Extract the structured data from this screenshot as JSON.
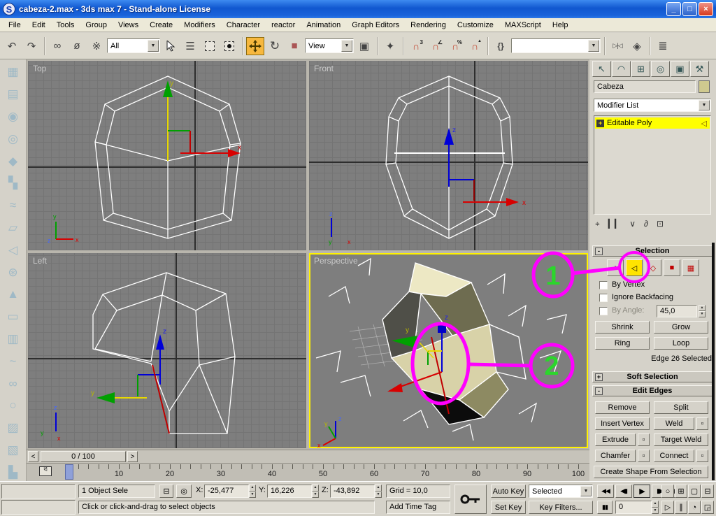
{
  "window": {
    "title": "cabeza-2.max - 3ds max 7  - Stand-alone License",
    "app_icon_letter": "S",
    "minimize": "_",
    "restore": "□",
    "close": "×"
  },
  "menu": [
    "File",
    "Edit",
    "Tools",
    "Group",
    "Views",
    "Create",
    "Modifiers",
    "Character",
    "reactor",
    "Animation",
    "Graph Editors",
    "Rendering",
    "Customize",
    "MAXScript",
    "Help"
  ],
  "toolbar": {
    "undo": "↶",
    "redo": "↷",
    "link": "∞",
    "unlink": "ø",
    "bind_spacewarp": "※",
    "selection_filter": "All",
    "select_by_name": "☰",
    "rotate": "↻",
    "scale": "■",
    "coord_system": "View",
    "pivot_center": "▣",
    "manipulate": "✦",
    "snap3": "∩",
    "snap3_badge": "3",
    "angle_snap": "∩",
    "angle_badge": "∠",
    "percent_snap": "∩",
    "percent_badge": "%",
    "spinner_snap": "∩",
    "spinner_badge": "▲",
    "named_sets": "{}",
    "named_selection_value": "",
    "mirror": "▷|◁",
    "align": "◈",
    "layers": "≣",
    "dd_arrow": "▼"
  },
  "left_toolbar_icons": [
    {
      "name": "geometry-boxes-icon",
      "glyph": "▦"
    },
    {
      "name": "cloth-shirt-icon",
      "glyph": "▤"
    },
    {
      "name": "ball-icon",
      "glyph": "◉"
    },
    {
      "name": "spinning-top-icon",
      "glyph": "◎"
    },
    {
      "name": "star-icon",
      "glyph": "◆"
    },
    {
      "name": "checker-icon",
      "glyph": "▚"
    },
    {
      "name": "spring-icon",
      "glyph": "≈"
    },
    {
      "name": "brush-icon",
      "glyph": "▱"
    },
    {
      "name": "light-cone-icon",
      "glyph": "◁"
    },
    {
      "name": "gear-icon",
      "glyph": "⊛"
    },
    {
      "name": "weather-vane-icon",
      "glyph": "▲"
    },
    {
      "name": "vehicle-icon",
      "glyph": "▭"
    },
    {
      "name": "book-icon",
      "glyph": "▥"
    },
    {
      "name": "water-icon",
      "glyph": "~"
    },
    {
      "name": "torus-rings-icon",
      "glyph": "∞"
    },
    {
      "name": "ragdoll-icon",
      "glyph": "○"
    },
    {
      "name": "sponge-icon",
      "glyph": "▨"
    },
    {
      "name": "crates-icon",
      "glyph": "▧"
    },
    {
      "name": "seat-icon",
      "glyph": "▙"
    }
  ],
  "viewports": {
    "top": "Top",
    "front": "Front",
    "left": "Left",
    "perspective": "Perspective"
  },
  "timeline": {
    "prev": "<",
    "next": ">",
    "slider_label": "0 / 100",
    "tick_labels": [
      "0",
      "10",
      "20",
      "30",
      "40",
      "50",
      "60",
      "70",
      "80",
      "90",
      "100"
    ]
  },
  "statusbar": {
    "selection_status": "1 Object Sele",
    "x_label": "X:",
    "x_value": "-25,477",
    "y_label": "Y:",
    "y_value": "16,226",
    "z_label": "Z:",
    "z_value": "-43,892",
    "grid_label": "Grid = 10,0",
    "prompt": "Click or click-and-drag to select objects",
    "add_time_tag": "Add Time Tag"
  },
  "animation": {
    "auto_key": "Auto Key",
    "set_key": "Set Key",
    "selection_set": "Selected",
    "key_filters": "Key Filters...",
    "frame_value": "0",
    "playback": [
      {
        "name": "go-to-start-button",
        "glyph": "◀◀"
      },
      {
        "name": "previous-frame-button",
        "glyph": "◀▮"
      },
      {
        "name": "play-button",
        "glyph": "▶"
      },
      {
        "name": "next-frame-button",
        "glyph": "▮▶"
      },
      {
        "name": "go-to-end-button",
        "glyph": "▶▶"
      }
    ],
    "key_mode_toggle": "▮▮"
  },
  "nav_icons_row1": [
    {
      "name": "zoom-icon",
      "glyph": "○"
    },
    {
      "name": "zoom-all-icon",
      "glyph": "⊞"
    },
    {
      "name": "zoom-extents-icon",
      "glyph": "▢"
    },
    {
      "name": "zoom-extents-all-icon",
      "glyph": "⊟"
    }
  ],
  "nav_icons_row2": [
    {
      "name": "field-of-view-icon",
      "glyph": "▷"
    },
    {
      "name": "pan-icon",
      "glyph": "∥"
    },
    {
      "name": "arc-rotate-icon",
      "glyph": "◔"
    },
    {
      "name": "min-max-toggle-icon",
      "glyph": "◲"
    }
  ],
  "command_panel": {
    "tabs": [
      {
        "name": "tab-create",
        "glyph": "↖"
      },
      {
        "name": "tab-modify",
        "glyph": "◠"
      },
      {
        "name": "tab-hierarchy",
        "glyph": "⊞"
      },
      {
        "name": "tab-motion",
        "glyph": "◎"
      },
      {
        "name": "tab-display",
        "glyph": "▣"
      },
      {
        "name": "tab-utilities",
        "glyph": "⚒"
      }
    ],
    "object_name": "Cabeza",
    "modifier_list_label": "Modifier List",
    "stack_item": {
      "expand": "+",
      "label": "Editable Poly",
      "subobject_icon": "◁"
    },
    "stack_tools": [
      {
        "name": "pin-stack-icon",
        "glyph": "⌖"
      },
      {
        "name": "show-end-result-icon",
        "glyph": "▎▎"
      },
      {
        "name": "make-unique-icon",
        "glyph": "∨"
      },
      {
        "name": "remove-modifier-icon",
        "glyph": "∂"
      },
      {
        "name": "configure-modifier-sets-icon",
        "glyph": "⊡"
      }
    ],
    "selection": {
      "title": "Selection",
      "collapse": "-",
      "by_vertex": "By Vertex",
      "ignore_backfacing": "Ignore Backfacing",
      "by_angle_label": "By Angle:",
      "by_angle_value": "45,0",
      "shrink": "Shrink",
      "grow": "Grow",
      "ring": "Ring",
      "loop": "Loop",
      "status_text": "Edge 26 Selected",
      "subobject_icons": [
        "vertex",
        "edge",
        "border",
        "polygon",
        "element"
      ]
    },
    "soft_selection": {
      "title": "Soft Selection",
      "collapse": "+"
    },
    "edit_edges": {
      "title": "Edit Edges",
      "collapse": "-",
      "remove": "Remove",
      "split": "Split",
      "insert_vertex": "Insert Vertex",
      "weld": "Weld",
      "extrude": "Extrude",
      "target_weld": "Target Weld",
      "chamfer": "Chamfer",
      "connect": "Connect",
      "create_shape": "Create Shape From Selection"
    }
  },
  "annotations": {
    "callout_1": "1",
    "callout_2": "2"
  },
  "colors": {
    "annotation_magenta": "#FF00FF",
    "callout_green": "#2BD62B",
    "active_tool_yellow": "#F7B83E",
    "stack_highlight": "#FFFF00",
    "active_viewport_border": "#FFF200",
    "axis_x": "#D80000",
    "axis_y": "#00A000",
    "axis_z": "#0000D8"
  }
}
